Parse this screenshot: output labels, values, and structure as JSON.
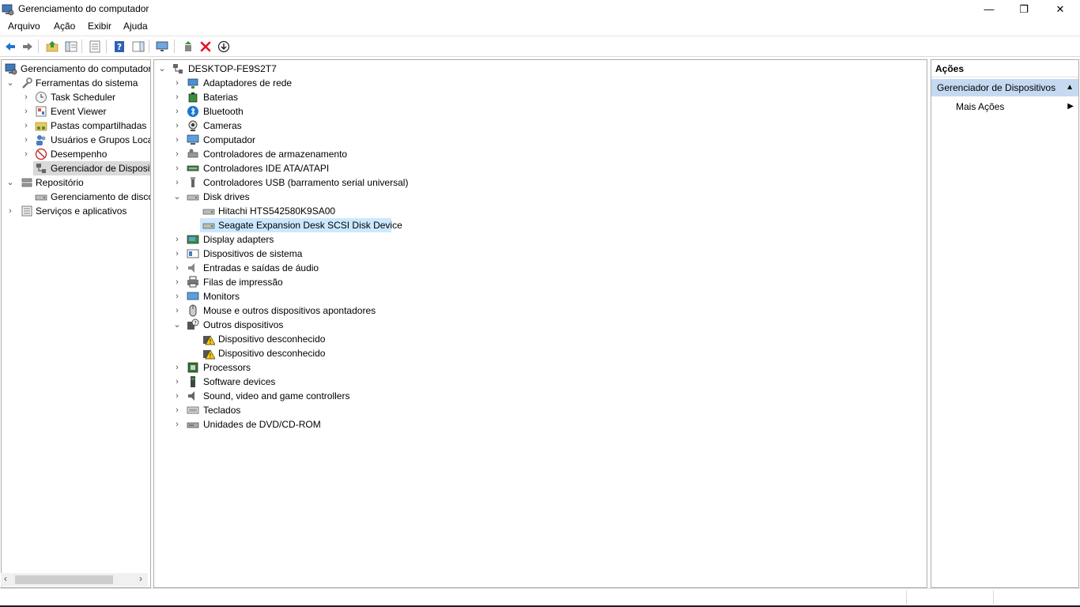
{
  "window": {
    "title": "Gerenciamento do computador",
    "controls": {
      "minimize": "—",
      "restore": "❐",
      "close": "✕"
    }
  },
  "menu": [
    "Arquivo",
    "Ação",
    "Exibir",
    "Ajuda"
  ],
  "toolbar": [
    "back-icon",
    "forward-icon",
    "up-folder-icon",
    "show-hide-tree-icon",
    "properties-icon",
    "help-icon",
    "show-action-pane-icon",
    "scan-hardware-icon",
    "add-driver-icon",
    "uninstall-icon",
    "update-driver-icon"
  ],
  "left_tree": {
    "root": "Gerenciamento do computador",
    "items": [
      {
        "label": "Ferramentas do sistema",
        "icon": "tools-icon"
      },
      {
        "label": "Task Scheduler",
        "icon": "clock-icon"
      },
      {
        "label": "Event Viewer",
        "icon": "event-viewer-icon"
      },
      {
        "label": "Pastas compartilhadas",
        "icon": "shared-folder-icon"
      },
      {
        "label": "Usuários e Grupos Loca",
        "icon": "users-icon"
      },
      {
        "label": "Desempenho",
        "icon": "performance-icon"
      },
      {
        "label": "Gerenciador de Disposit",
        "icon": "device-manager-icon"
      },
      {
        "label": "Repositório",
        "icon": "storage-icon"
      },
      {
        "label": "Gerenciamento de disco",
        "icon": "disk-management-icon"
      },
      {
        "label": "Serviços e aplicativos",
        "icon": "services-icon"
      }
    ]
  },
  "devices": {
    "computer": "DESKTOP-FE9S2T7",
    "categories": [
      "Adaptadores de rede",
      "Baterias",
      "Bluetooth",
      "Cameras",
      "Computador",
      "Controladores de armazenamento",
      "Controladores IDE ATA/ATAPI",
      "Controladores USB (barramento serial universal)",
      "Disk drives",
      "Display adapters",
      "Dispositivos de sistema",
      "Entradas e saídas de áudio",
      "Filas de impressão",
      "Monitors",
      "Mouse e outros dispositivos apontadores",
      "Outros dispositivos",
      "Processors",
      "Software devices",
      "Sound, video and game controllers",
      "Teclados",
      "Unidades de DVD/CD-ROM"
    ],
    "disk_drives": [
      "Hitachi HTS542580K9SA00",
      "Seagate Expansion Desk SCSI Disk Device"
    ],
    "other_devices": [
      "Dispositivo desconhecido",
      "Dispositivo desconhecido"
    ]
  },
  "actions": {
    "header": "Ações",
    "group": "Gerenciador de Dispositivos",
    "more": "Mais Ações"
  },
  "colors": {
    "selection": "#cce8ff",
    "actions_group_bg": "#c5daf0",
    "tree_selected_bg": "#d9d9d9",
    "accent_blue": "#1e74d2",
    "delete_red": "#e81123"
  }
}
